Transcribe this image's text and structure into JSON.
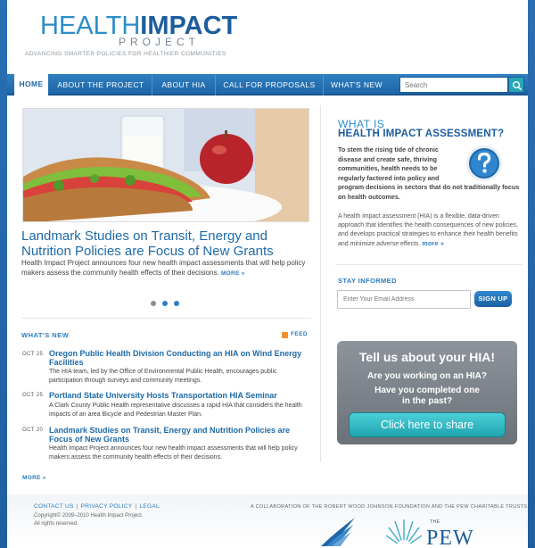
{
  "header": {
    "logo_light": "HEALTH",
    "logo_bold": "IMPACT",
    "logo_sub": "PROJECT",
    "tagline": "ADVANCING SMARTER POLICIES FOR HEALTHIER COMMUNITIES"
  },
  "nav": {
    "items": [
      {
        "label": "HOME"
      },
      {
        "label": "ABOUT THE PROJECT"
      },
      {
        "label": "ABOUT HIA"
      },
      {
        "label": "CALL FOR PROPOSALS"
      },
      {
        "label": "WHAT'S NEW"
      }
    ],
    "search_placeholder": "Search"
  },
  "hero": {
    "title": "Landmark Studies on Transit, Energy and Nutrition Policies are Focus of New Grants",
    "description": "Health Impact Project announces four new health impact assessments that will help policy makers assess the community health effects of their decisions.",
    "more": "MORE »"
  },
  "whats_new": {
    "title": "WHAT'S NEW",
    "feed": "FEED",
    "items": [
      {
        "date": "OCT 25",
        "title": "Oregon Public Health Division Conducting an HIA on Wind Energy Facilities",
        "body": "The HIA team, led by the Office of Environmental Public Health, encourages public participation through surveys and community meetings."
      },
      {
        "date": "OCT 25",
        "title": "Portland State University Hosts Transportation HIA Seminar",
        "body": "A Clark County Public Health representative discusses a rapid HIA that considers the health impacts of an area Bicycle and Pedestrian Master Plan."
      },
      {
        "date": "OCT 20",
        "title": "Landmark Studies on Transit, Energy and Nutrition Policies are Focus of New Grants",
        "body": "Health Impact Project announces four new health impact assessments that will help policy makers assess the community health effects of their decisions."
      }
    ],
    "more": "MORE »"
  },
  "hia": {
    "small": "WHAT IS",
    "big": "HEALTH IMPACT ASSESSMENT?",
    "lead_a": "To stem the rising tide of chronic disease and create safe, thriving communities, health needs to be regularly factored into policy and",
    "lead_b": "program decisions in sectors that do not traditionally focus on health outcomes.",
    "body": "A health impact assessment (HIA) is a flexible, data-driven approach that identifies the health consequences of new policies, and develops practical strategies to enhance their health benefits and minimize adverse effects.",
    "more": "more »"
  },
  "stay": {
    "title": "STAY INFORMED",
    "email_placeholder": "Enter Your Email Address",
    "signup": "SIGN UP"
  },
  "tell": {
    "heading": "Tell us about your HIA!",
    "q1": "Are you working on an HIA?",
    "q2a": "Have you completed one",
    "q2b": "in the past?",
    "share": "Click here to share"
  },
  "footer": {
    "contact": "CONTACT US",
    "privacy": "PRIVACY POLICY",
    "legal": "LEGAL",
    "sep": "|",
    "copyright": "Copyright© 2009–2010 Health Impact Project.",
    "rights": "All rights reserved.",
    "collab": "A COLLABORATION OF THE ROBERT WOOD JOHNSON FOUNDATION AND THE PEW CHARITABLE TRUSTS",
    "pew_the": "THE",
    "pew": "PEW"
  },
  "colors": {
    "brand_blue": "#1f66a8",
    "accent_teal": "#25a7b5",
    "link_blue": "#2a7cbf"
  }
}
